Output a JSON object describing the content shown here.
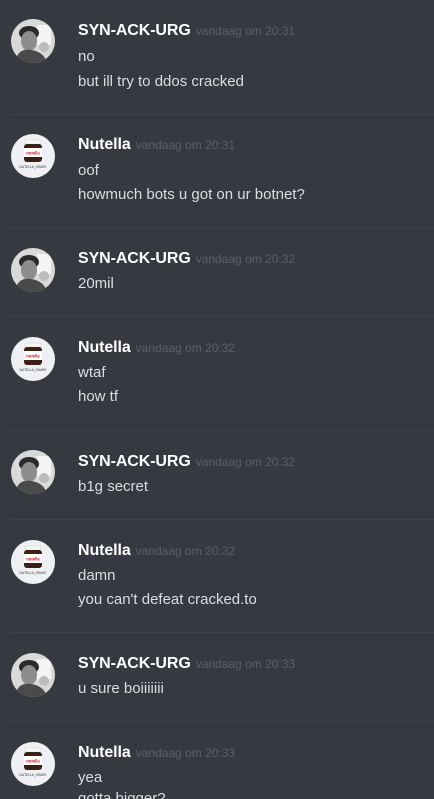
{
  "messages": [
    {
      "author": "SYN-ACK-URG",
      "time": "vandaag om 20:31",
      "lines": [
        "no",
        "but ill try to ddos cracked"
      ]
    },
    {
      "author": "Nutella",
      "time": "vandaag om 20:31",
      "lines": [
        "oof",
        "howmuch bots u got on ur botnet?"
      ]
    },
    {
      "author": "SYN-ACK-URG",
      "time": "vandaag om 20:32",
      "lines": [
        "20mil"
      ]
    },
    {
      "author": "Nutella",
      "time": "vandaag om 20:32",
      "lines": [
        "wtaf",
        "how tf"
      ]
    },
    {
      "author": "SYN-ACK-URG",
      "time": "vandaag om 20:32",
      "lines": [
        "b1g secret"
      ]
    },
    {
      "author": "Nutella",
      "time": "vandaag om 20:32",
      "lines": [
        "damn",
        "you can't defeat cracked.to"
      ]
    },
    {
      "author": "SYN-ACK-URG",
      "time": "vandaag om 20:33",
      "lines": [
        "u sure boiiiiiii"
      ]
    },
    {
      "author": "Nutella",
      "time": "vandaag om 20:33",
      "lines": [
        "yea",
        "gotta bigger?"
      ]
    }
  ],
  "avatar_labels": {
    "nutella_jar": "nutella",
    "nutella_caption": "NUTELLA_SHAKE"
  },
  "colors": {
    "background": "#36393f",
    "username": "#ffffff",
    "timestamp": "#5d6068",
    "message_text": "#dcddde",
    "divider": "#40434a"
  }
}
